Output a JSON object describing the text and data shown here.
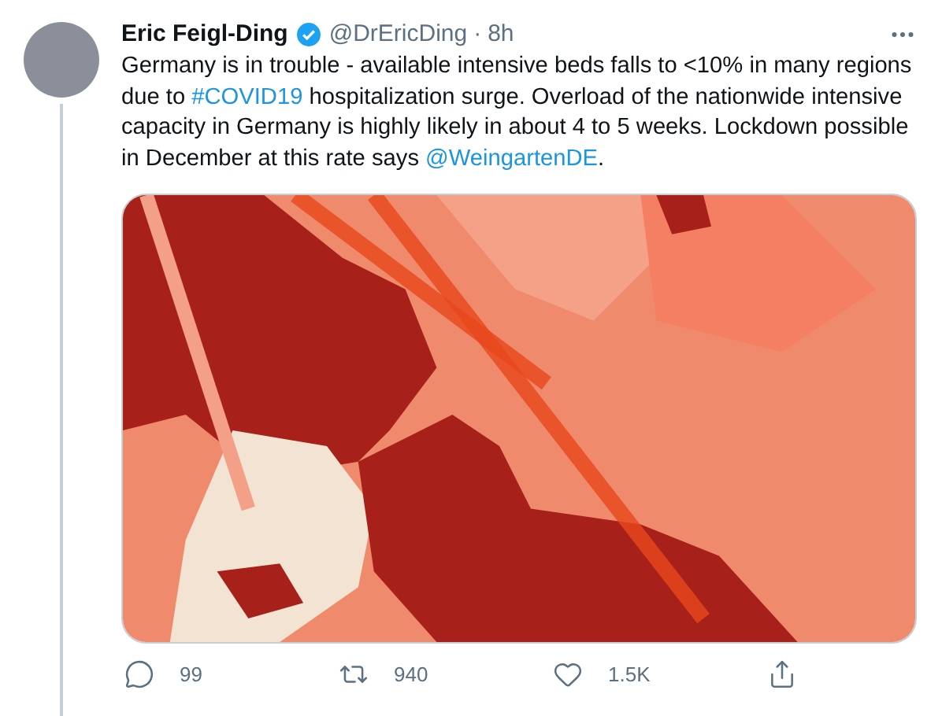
{
  "tweet": {
    "author": "Eric Feigl-Ding",
    "verified": true,
    "handle": "@DrEricDing",
    "separator": "·",
    "time": "8h",
    "body": [
      {
        "kind": "text",
        "text": "Germany is in trouble - available intensive beds falls to <10% in many regions due to "
      },
      {
        "kind": "hashtag",
        "text": "#COVID19"
      },
      {
        "kind": "text",
        "text": " hospitalization surge. Overload of the nationwide intensive capacity in Germany is highly likely in about 4 to 5 weeks. Lockdown possible in December at this rate says "
      },
      {
        "kind": "mention",
        "text": "@WeingartenDE"
      },
      {
        "kind": "text",
        "text": "."
      }
    ]
  },
  "actions": [
    {
      "kind": "reply",
      "count": "99"
    },
    {
      "kind": "retweet",
      "count": "940"
    },
    {
      "kind": "like",
      "count": "1.5K"
    },
    {
      "kind": "share"
    }
  ]
}
